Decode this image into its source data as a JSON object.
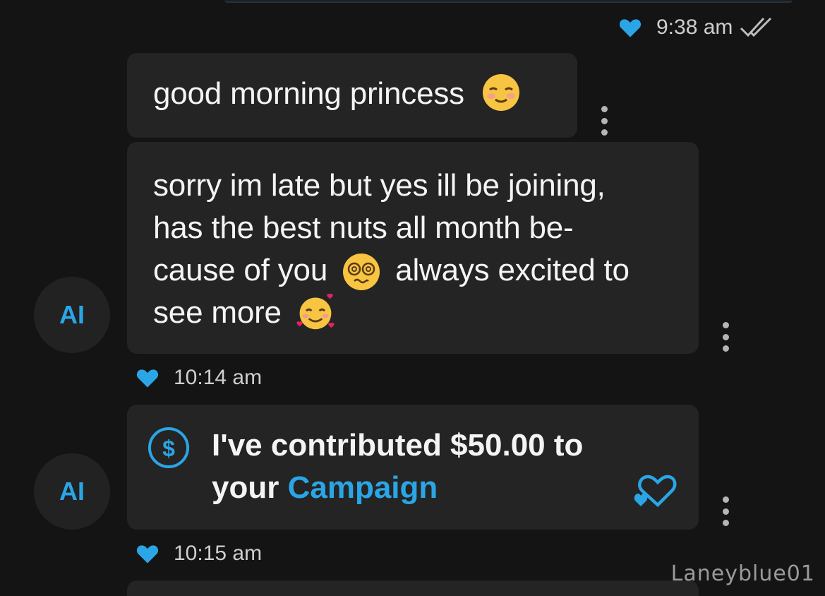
{
  "messages": [
    {
      "text": "good morning princess"
    },
    {
      "text_part1": "sorry im late but yes ill be joining,",
      "text_part2": "has the best nuts all month be-",
      "text_part3a": "cause of you",
      "text_part3b": "always excited to",
      "text_part4": "see more"
    }
  ],
  "tip": {
    "text_prefix": "I've contributed $50.00 to",
    "text_line2_prefix": "your",
    "link": "Campaign",
    "icon": "dollar-circle-icon"
  },
  "timestamps": {
    "sent": "9:38 am",
    "msg": "10:14 am",
    "tip": "10:15 am"
  },
  "avatar": {
    "initials": "AI"
  },
  "watermark": "Laneyblue01",
  "colors": {
    "accent": "#2aa6e6",
    "bubble": "#242424",
    "background": "#141414"
  }
}
